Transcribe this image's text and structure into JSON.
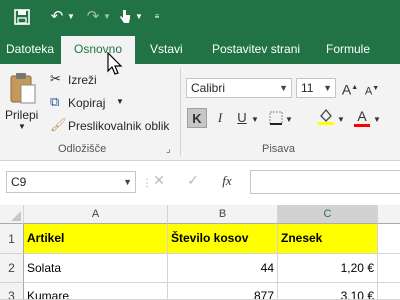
{
  "tabs": [
    "Datoteka",
    "Osnovno",
    "Vstavi",
    "Postavitev strani",
    "Formule"
  ],
  "active_tab": "Osnovno",
  "clipboard": {
    "paste_label": "Prilepi",
    "cut_label": "Izreži",
    "copy_label": "Kopiraj",
    "format_painter_label": "Preslikovalnik oblik",
    "group_label": "Odložišče"
  },
  "font": {
    "name": "Calibri",
    "size": "11",
    "bold": "K",
    "italic": "I",
    "underline": "U",
    "group_label": "Pisava"
  },
  "formula_bar": {
    "name_box": "C9",
    "fx": "fx",
    "value": ""
  },
  "columns": [
    "A",
    "B",
    "C"
  ],
  "rows": [
    {
      "num": "1",
      "a": "Artikel",
      "b": "Število kosov",
      "c": "Znesek"
    },
    {
      "num": "2",
      "a": "Solata",
      "b": "44",
      "c": "1,20 €"
    },
    {
      "num": "3",
      "a": "Kumare",
      "b": "877",
      "c": "3,10 €"
    }
  ],
  "colors": {
    "brand": "#217346",
    "header_fill": "#ffff00"
  }
}
